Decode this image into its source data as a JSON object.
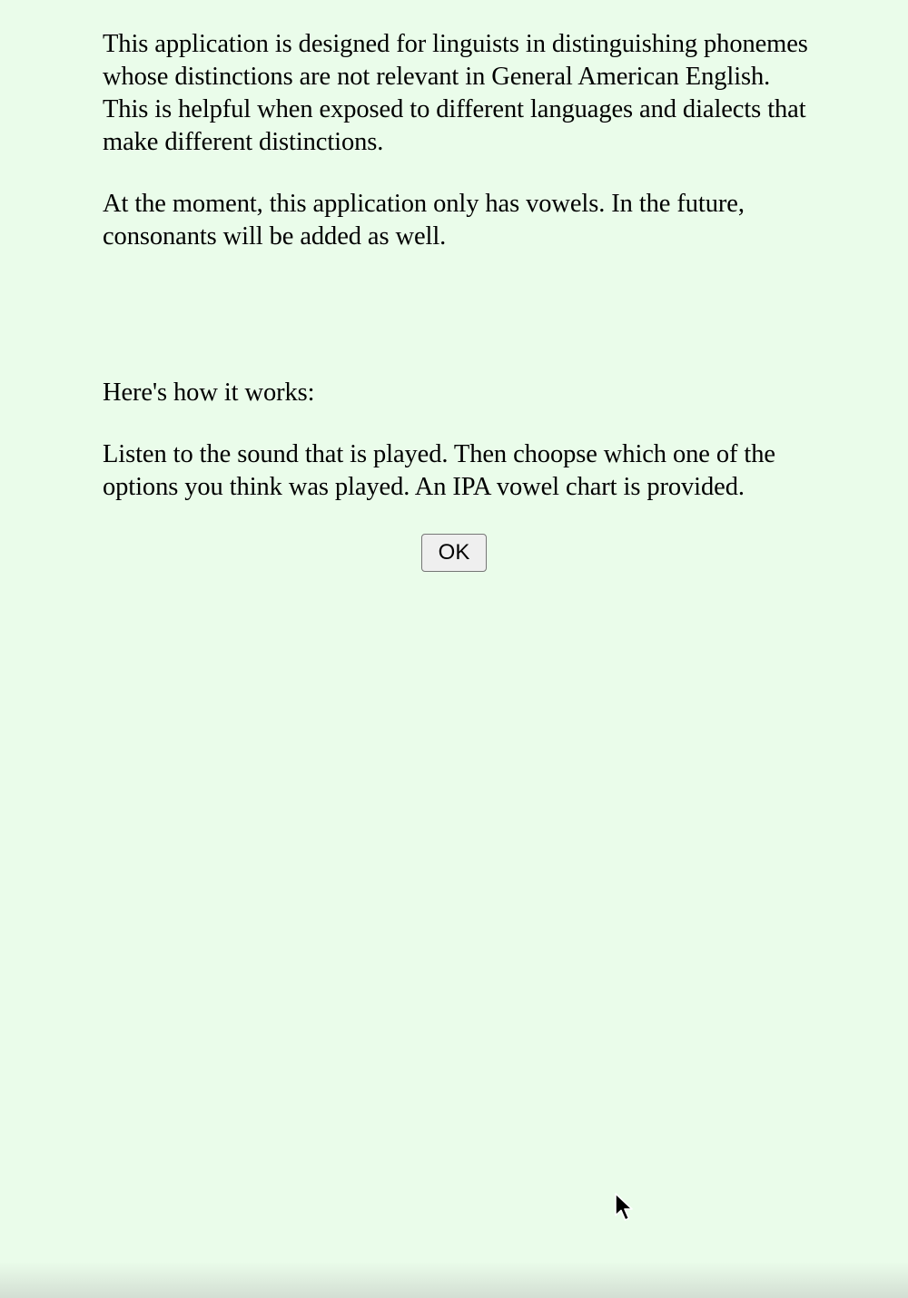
{
  "intro": {
    "paragraph1": "This application is designed for linguists in distinguishing phonemes whose distinctions are not relevant in General American English. This is helpful when exposed to different languages and dialects that make different distinctions.",
    "paragraph2": "At the moment, this application only has vowels. In the future, consonants will be added as well.",
    "how_heading": "Here's how it works:",
    "paragraph3": "Listen to the sound that is played. Then choopse which one of the options you think was played. An IPA vowel chart is provided."
  },
  "actions": {
    "ok_label": "OK"
  },
  "colors": {
    "background": "#eafcea",
    "text": "#000000"
  },
  "icons": {
    "pointer": "mouse-pointer-icon"
  }
}
